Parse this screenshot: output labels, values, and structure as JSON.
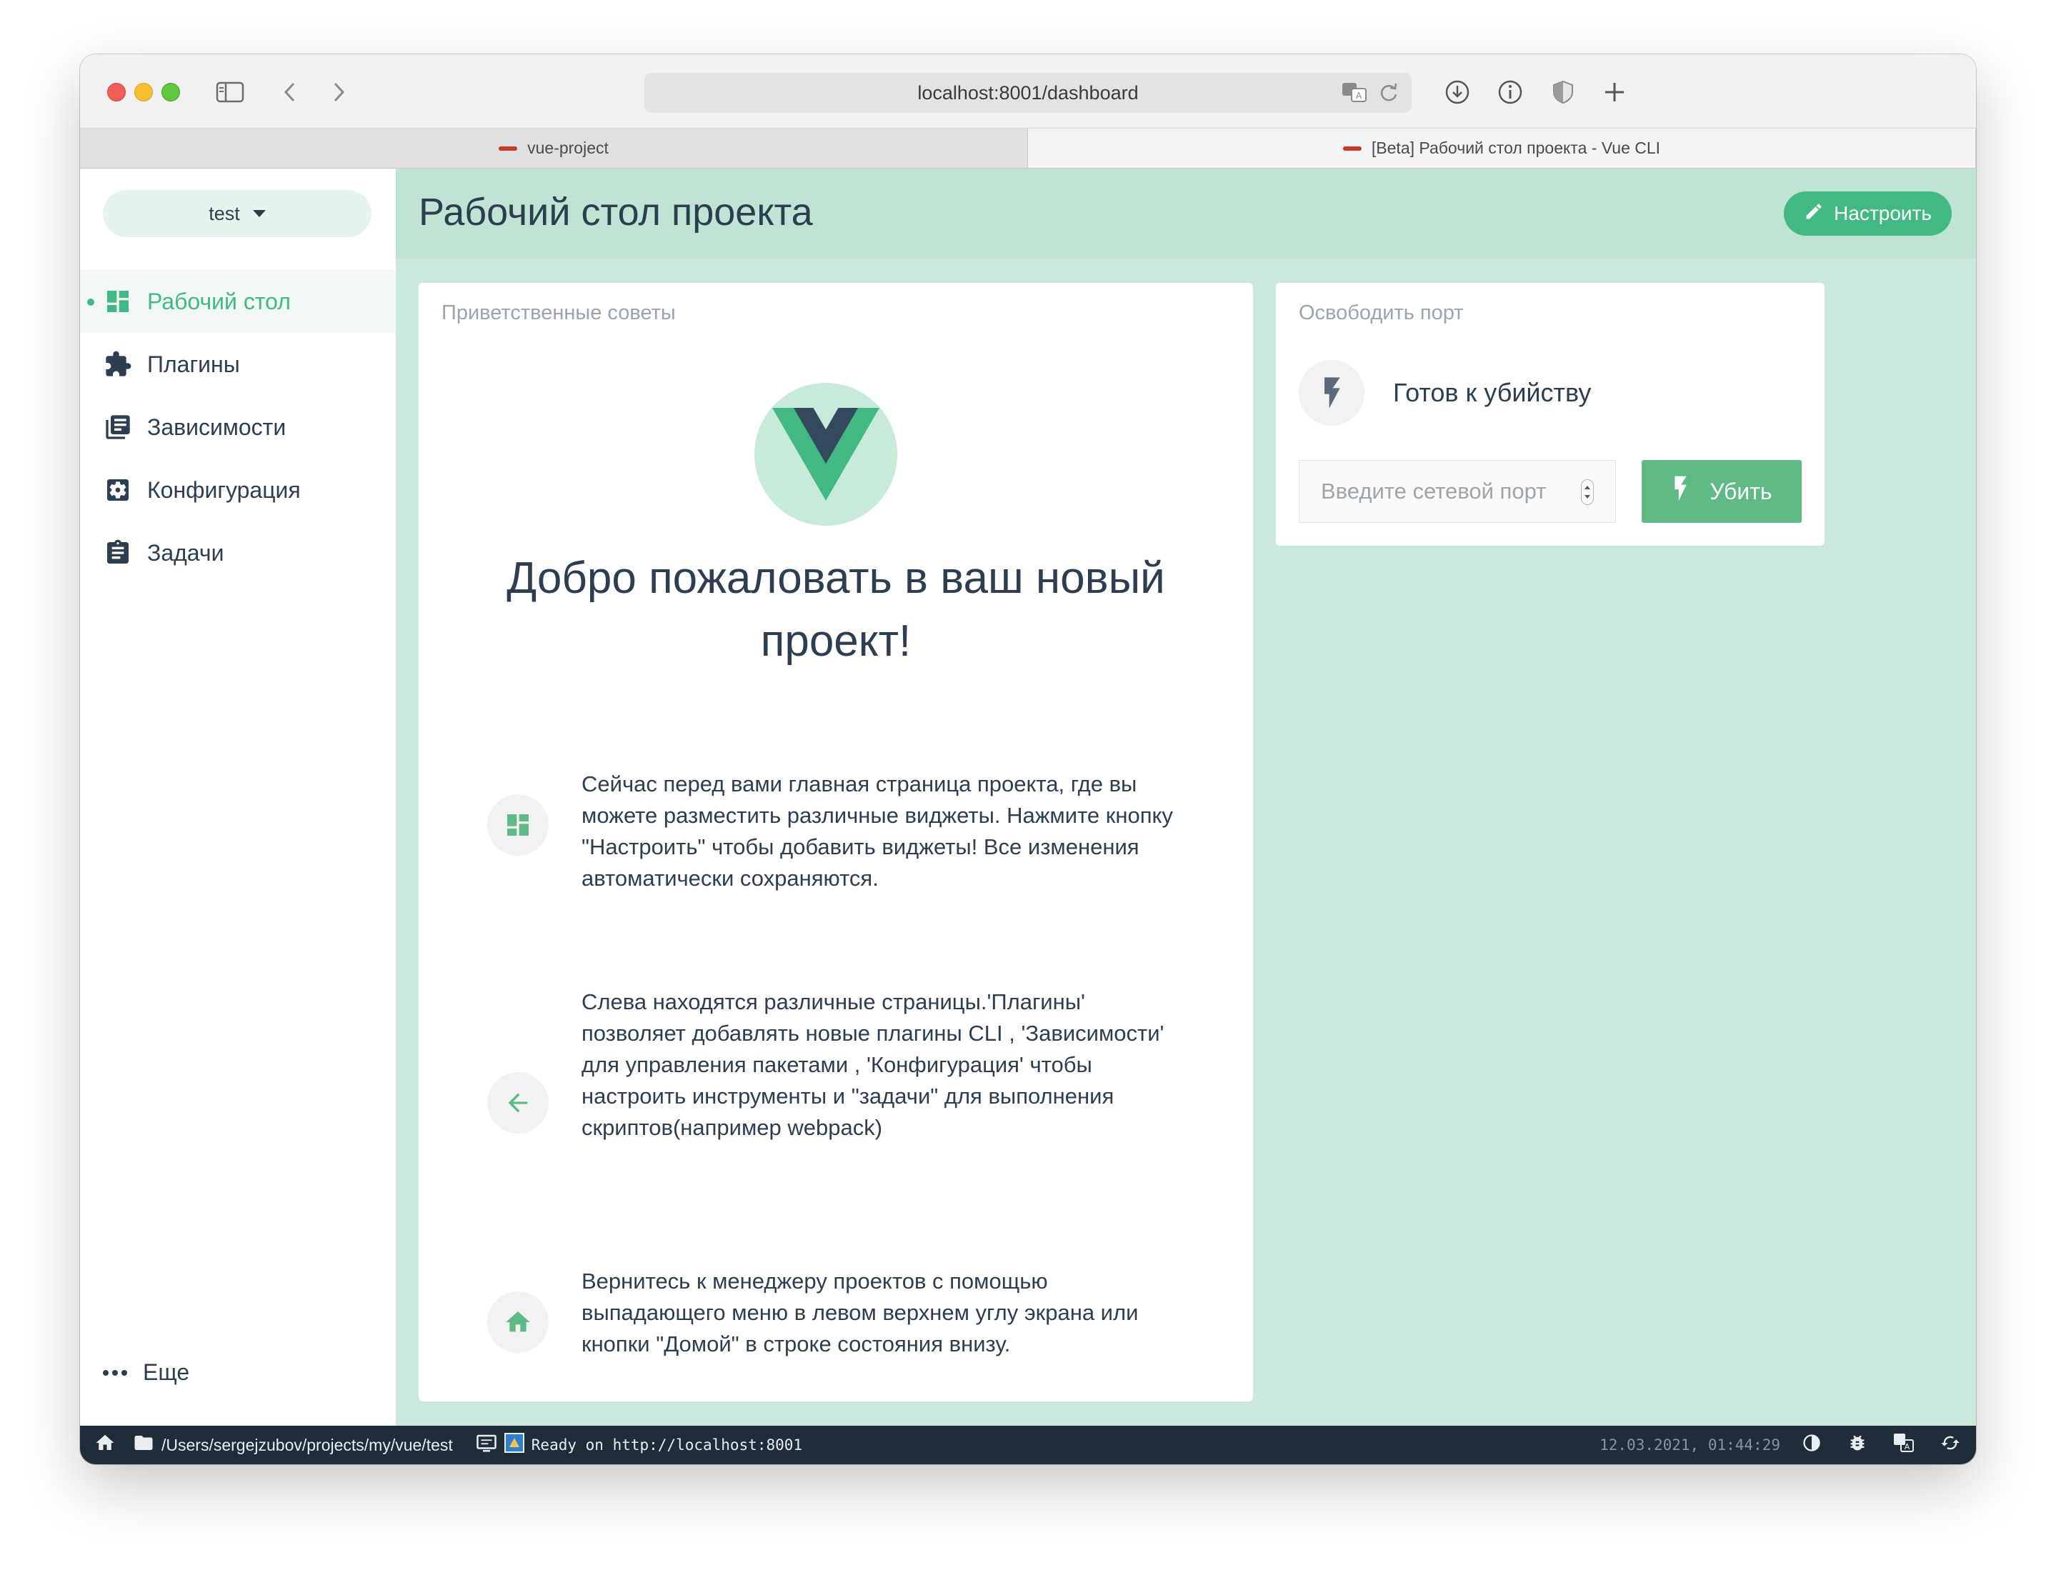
{
  "browser": {
    "url": "localhost:8001/dashboard",
    "tabs": [
      {
        "label": "vue-project",
        "active": false
      },
      {
        "label": "[Beta] Рабочий стол проекта - Vue CLI",
        "active": true
      }
    ]
  },
  "sidebar": {
    "project": "test",
    "items": [
      {
        "label": "Рабочий стол",
        "icon": "dashboard-icon",
        "active": true
      },
      {
        "label": "Плагины",
        "icon": "puzzle-icon",
        "active": false
      },
      {
        "label": "Зависимости",
        "icon": "library-books-icon",
        "active": false
      },
      {
        "label": "Конфигурация",
        "icon": "settings-applications-icon",
        "active": false
      },
      {
        "label": "Задачи",
        "icon": "assignment-icon",
        "active": false
      }
    ],
    "more": "Еще"
  },
  "header": {
    "title": "Рабочий стол проекта",
    "customize": "Настроить"
  },
  "welcome": {
    "card_title": "Приветственные советы",
    "title": "Добро пожаловать в ваш новый проект!",
    "tips": [
      {
        "icon": "dashboard-icon",
        "text": "Сейчас перед вами главная страница проекта, где вы можете разместить различные виджеты. Нажмите кнопку \"Настроить\" чтобы добавить виджеты! Все изменения автоматически сохраняются."
      },
      {
        "icon": "arrow-back-icon",
        "text": "Слева находятся различные страницы.'Плагины' позволяет добавлять новые плагины CLI , 'Зависимости' для управления пакетами , 'Конфигурация' чтобы настроить инструменты и \"задачи\" для выполнения скриптов(например webpack)"
      },
      {
        "icon": "home-icon",
        "text": "Вернитесь к менеджеру проектов с помощью выпадающего меню в левом верхнем углу экрана или кнопки \"Домой\" в строке состояния внизу."
      }
    ]
  },
  "port_widget": {
    "card_title": "Освободить порт",
    "status": "Готов к убийству",
    "placeholder": "Введите сетевой порт",
    "kill": "Убить"
  },
  "statusbar": {
    "path": "/Users/sergejzubov/projects/my/vue/test",
    "log": "Ready on http://localhost:8001",
    "time": "12.03.2021, 01:44:29"
  },
  "colors": {
    "accent": "#42b983",
    "main_bg": "#cbe8dc",
    "header_bg": "#c0e3d3",
    "statusbar_bg": "#1f2d3a"
  }
}
